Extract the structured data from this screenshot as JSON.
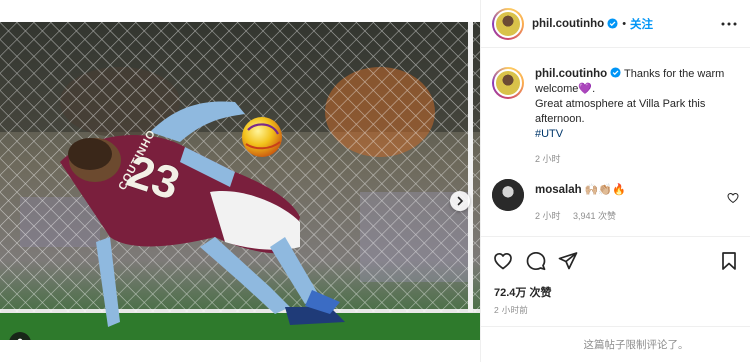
{
  "post": {
    "author": "phil.coutinho",
    "follow_label": "关注",
    "separator": "•",
    "media": {
      "jersey_name": "COUTINHO",
      "jersey_number": "23",
      "carousel_count": 4,
      "carousel_active_index": 0
    }
  },
  "caption": {
    "author": "phil.coutinho",
    "text_line1": " Thanks for the warm welcome💜.",
    "text_line2": "Great atmosphere at Villa Park this afternoon.",
    "hashtag": "#UTV",
    "time": "2 小时"
  },
  "comment": {
    "author": "mosalah",
    "text": " 🙌🏼👏🏼🔥",
    "time": "2 小时",
    "likes": "3,941 次赞"
  },
  "stats": {
    "likes": "72.4万 次赞",
    "age": "2 小时前",
    "comments_restricted": "这篇帖子限制评论了。"
  },
  "colors": {
    "accent": "#0095f6",
    "verified": "#0095f6",
    "hashtag": "#00376b",
    "muted": "#8e8e8e"
  },
  "icons": {
    "header_more": "more-horizontal-icon",
    "verified": "verified-badge-icon",
    "like": "heart-icon",
    "comment": "comment-bubble-icon",
    "share": "paper-plane-icon",
    "save": "bookmark-icon",
    "next": "chevron-right-icon",
    "tags": "user-tag-icon"
  }
}
